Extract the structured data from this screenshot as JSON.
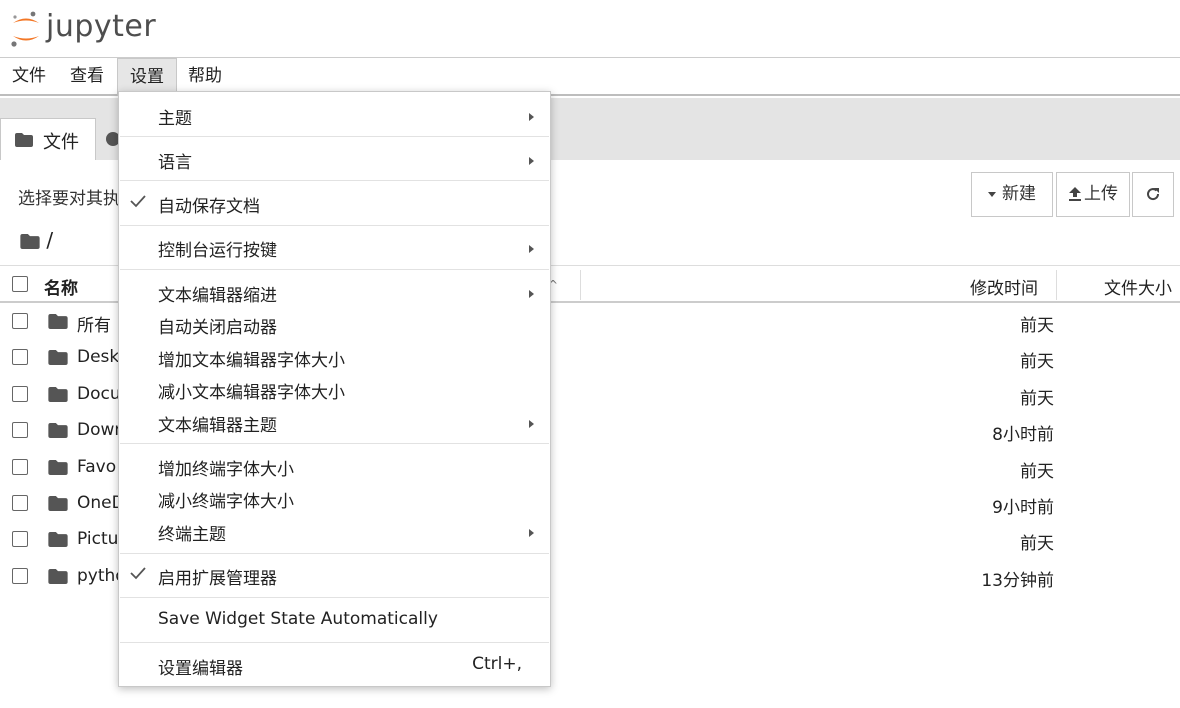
{
  "header": {
    "brand": "jupyter"
  },
  "menubar": {
    "items": [
      "文件",
      "查看",
      "设置",
      "帮助"
    ],
    "active": "设置"
  },
  "tabs": {
    "files_tab": "文件"
  },
  "toolbar": {
    "hint": "选择要对其执",
    "new_label": "新建",
    "upload_label": "上传"
  },
  "path": "/",
  "table": {
    "headers": {
      "name": "名称",
      "modified": "修改时间",
      "size": "文件大小"
    },
    "rows": [
      {
        "name": "所有",
        "modified": "前天"
      },
      {
        "name": "Desk",
        "modified": "前天"
      },
      {
        "name": "Docu",
        "modified": "前天"
      },
      {
        "name": "Dowr",
        "modified": "8小时前"
      },
      {
        "name": "Favo",
        "modified": "前天"
      },
      {
        "name": "OneD",
        "modified": "9小时前"
      },
      {
        "name": "Pictu",
        "modified": "前天"
      },
      {
        "name": "pytho",
        "modified": "13分钟前"
      }
    ]
  },
  "settings_menu": {
    "items": [
      {
        "label": "主题",
        "submenu": true
      },
      {
        "label": "语言",
        "submenu": true
      },
      {
        "label": "自动保存文档",
        "checked": true
      },
      {
        "label": "控制台运行按键",
        "submenu": true
      },
      {
        "label": "文本编辑器缩进",
        "submenu": true
      },
      {
        "label": "自动关闭启动器"
      },
      {
        "label": "增加文本编辑器字体大小"
      },
      {
        "label": "减小文本编辑器字体大小"
      },
      {
        "label": "文本编辑器主题",
        "submenu": true
      },
      {
        "label": "增加终端字体大小"
      },
      {
        "label": "减小终端字体大小"
      },
      {
        "label": "终端主题",
        "submenu": true
      },
      {
        "label": "启用扩展管理器",
        "checked": true
      },
      {
        "label": "Save Widget State Automatically"
      },
      {
        "label": "设置编辑器",
        "shortcut": "Ctrl+,"
      }
    ]
  },
  "colors": {
    "jupyter_orange": "#f37726",
    "active_menu_bg": "#e6e6e6",
    "tab_area_bg": "#e4e4e4"
  }
}
